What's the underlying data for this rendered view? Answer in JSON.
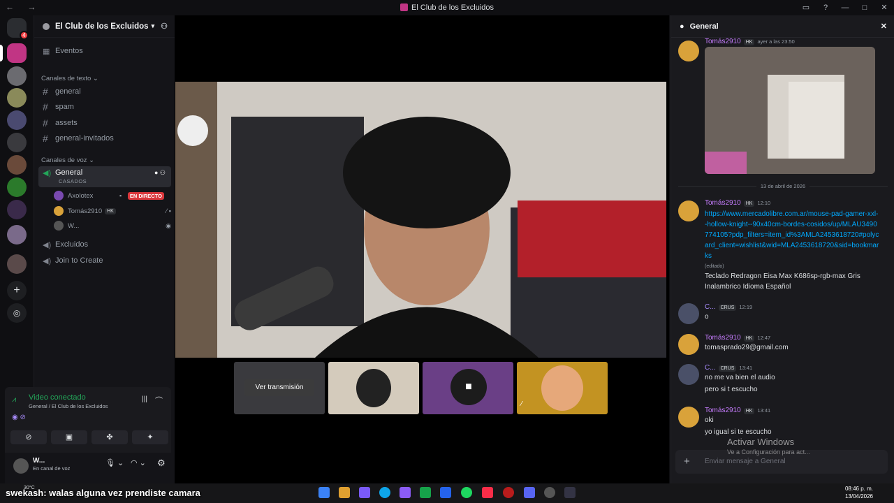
{
  "window": {
    "title": "El Club de los Excluidos"
  },
  "server": {
    "name": "El Club de los Excluidos"
  },
  "sidebar": {
    "events": "Eventos",
    "text_category": "Canales de texto",
    "text_channels": [
      "general",
      "spam",
      "assets",
      "general-invitados"
    ],
    "voice_category": "Canales de voz",
    "active_voice": {
      "name": "General",
      "status": "CASADOS"
    },
    "voice_users": [
      {
        "name": "Axolotex",
        "live": "EN DIRECTO"
      },
      {
        "name": "Tomás2910",
        "tag": "HK"
      },
      {
        "name": "W..."
      }
    ],
    "other_voice": [
      "Excluidos",
      "Join to Create"
    ]
  },
  "voice_panel": {
    "status": "Video conectado",
    "location": "General / El Club de los Excluidos"
  },
  "user": {
    "name": "W...",
    "status": "En canal de voz"
  },
  "stage": {
    "watch_label": "Ver transmisión"
  },
  "chat": {
    "title": "General",
    "date_divider": "13 de abril de 2026",
    "messages": [
      {
        "author": "Tomás2910",
        "tag": "HK",
        "time": "ayer a las 23:50"
      },
      {
        "author": "Tomás2910",
        "tag": "HK",
        "time": "12:10",
        "link": "https://www.mercadolibre.com.ar/mouse-pad-gamer-xxl--hollow-knight--90x40cm-bordes-cosidos/up/MLAU3490774105?pdp_filters=item_id%3AMLA2453618720#polycard_client=wishlist&wid=MLA2453618720&sid=bookmarks",
        "edited": "(editado)",
        "text": "Teclado Redragon Eisa Max K686sp-rgb-max Gris Inalambrico Idioma Español"
      },
      {
        "author": "C...",
        "tag": "CRUS",
        "time": "12:19",
        "text": "o"
      },
      {
        "author": "Tomás2910",
        "tag": "HK",
        "time": "12:47",
        "text": "tomasprado29@gmail.com"
      },
      {
        "author": "C...",
        "tag": "CRUS",
        "time": "13:41",
        "text": "no me va bien el audio",
        "text2": "pero si t escucho"
      },
      {
        "author": "Tomás2910",
        "tag": "HK",
        "time": "13:41",
        "text": "oki",
        "text2": "yo igual si te escucho"
      }
    ],
    "input_placeholder": "Enviar mensaje a General"
  },
  "watermark": {
    "title": "Activar Windows",
    "sub": "Ve a Configuración para act..."
  },
  "overlay": {
    "user": "swekash",
    "text": ": walas alguna vez prendiste camara"
  },
  "taskbar": {
    "weather": "30°C",
    "time": "08:46 p. m.",
    "date": "13/04/2026"
  },
  "colors": {
    "accent": "#5865f2",
    "online": "#23a559",
    "live": "#da373c",
    "mention": "#c77dff"
  }
}
